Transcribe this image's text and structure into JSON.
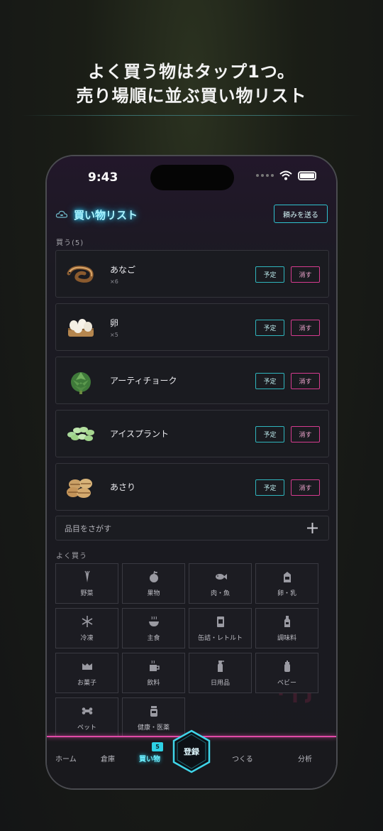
{
  "headline": {
    "line1": "よく買う物はタップ1つ。",
    "line2": "売り場順に並ぶ買い物リスト"
  },
  "status_bar": {
    "time": "9:43"
  },
  "header": {
    "title": "買い物リスト",
    "send_button": "頼みを送る"
  },
  "buy_section": {
    "label": "買う(5)"
  },
  "items": [
    {
      "name": "あなご",
      "qty": "×6",
      "plan": "予定",
      "delete": "消す",
      "icon": "anago-icon"
    },
    {
      "name": "卵",
      "qty": "×5",
      "plan": "予定",
      "delete": "消す",
      "icon": "egg-carton-icon"
    },
    {
      "name": "アーティチョーク",
      "qty": "",
      "plan": "予定",
      "delete": "消す",
      "icon": "artichoke-icon"
    },
    {
      "name": "アイスプラント",
      "qty": "",
      "plan": "予定",
      "delete": "消す",
      "icon": "ice-plant-icon"
    },
    {
      "name": "あさり",
      "qty": "",
      "plan": "予定",
      "delete": "消す",
      "icon": "clam-icon"
    }
  ],
  "search": {
    "placeholder": "品目をさがす"
  },
  "frequent": {
    "label": "よく買う",
    "categories": [
      {
        "label": "野菜",
        "icon": "carrot-icon"
      },
      {
        "label": "果物",
        "icon": "apple-icon"
      },
      {
        "label": "肉・魚",
        "icon": "fish-icon"
      },
      {
        "label": "卵・乳",
        "icon": "milk-carton-icon"
      },
      {
        "label": "冷凍",
        "icon": "snowflake-icon"
      },
      {
        "label": "主食",
        "icon": "rice-bowl-icon"
      },
      {
        "label": "缶詰・レトルト",
        "icon": "can-icon"
      },
      {
        "label": "調味料",
        "icon": "bottle-icon"
      },
      {
        "label": "お菓子",
        "icon": "candy-icon"
      },
      {
        "label": "飲料",
        "icon": "cup-icon"
      },
      {
        "label": "日用品",
        "icon": "spray-bottle-icon"
      },
      {
        "label": "ベビー",
        "icon": "baby-bottle-icon"
      },
      {
        "label": "ペット",
        "icon": "bone-icon"
      },
      {
        "label": "健康・医薬",
        "icon": "medicine-jar-icon"
      }
    ]
  },
  "tabbar": {
    "home": "ホーム",
    "storage": "倉庫",
    "shopping": "買い物",
    "shopping_badge": "5",
    "register": "登録",
    "cook": "つくる",
    "analysis": "分析"
  },
  "colors": {
    "accent_cyan": "#2fc2cf",
    "accent_pink": "#d63b8f",
    "title_glow": "#37d7ff"
  }
}
